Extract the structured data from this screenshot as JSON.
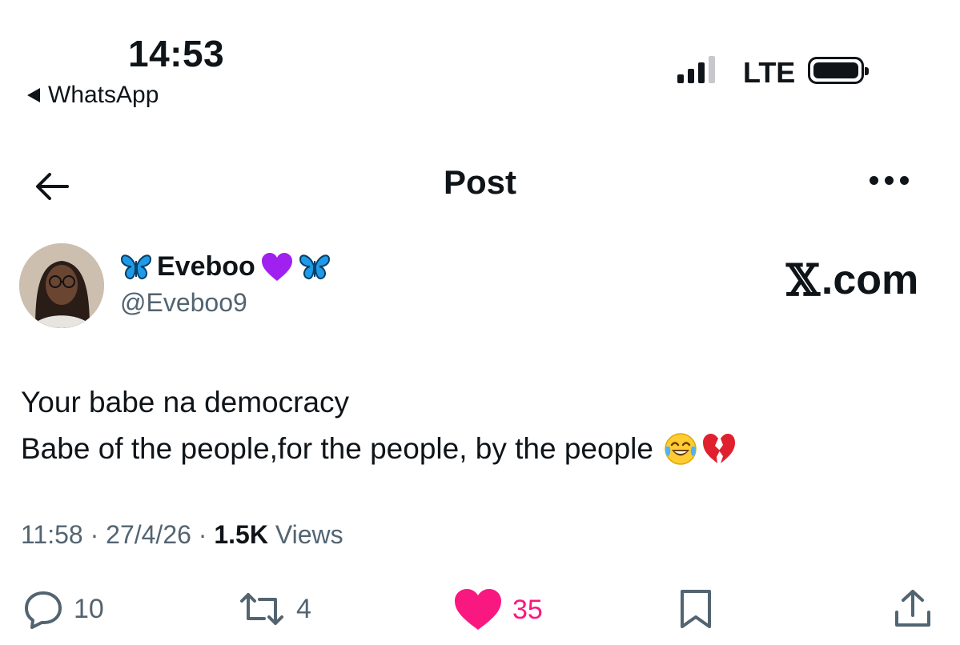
{
  "status_bar": {
    "time": "14:53",
    "back_app": "WhatsApp",
    "network": "LTE"
  },
  "header": {
    "title": "Post"
  },
  "author": {
    "display_name": "Eveboo",
    "handle": "@Eveboo9",
    "badge_icons": [
      "butterfly-icon",
      "purple-heart-icon",
      "butterfly-icon"
    ]
  },
  "watermark": {
    "logo_letter": "𝕏",
    "suffix": ".com"
  },
  "post": {
    "line1": "Your babe na democracy",
    "line2": "Babe of the people,for the people, by the people",
    "line2_emojis": [
      "face-with-tears-of-joy-icon",
      "broken-heart-icon"
    ],
    "time": "11:58",
    "date": "27/4/26",
    "views_count": "1.5K",
    "views_label": "Views",
    "separator": "·"
  },
  "actions": {
    "replies": "10",
    "reposts": "4",
    "likes": "35",
    "liked": true
  },
  "colors": {
    "text": "#0f1419",
    "secondary": "#536471",
    "like": "#f91880",
    "butterfly": "#1e9be8",
    "purple_heart": "#a020f0"
  }
}
